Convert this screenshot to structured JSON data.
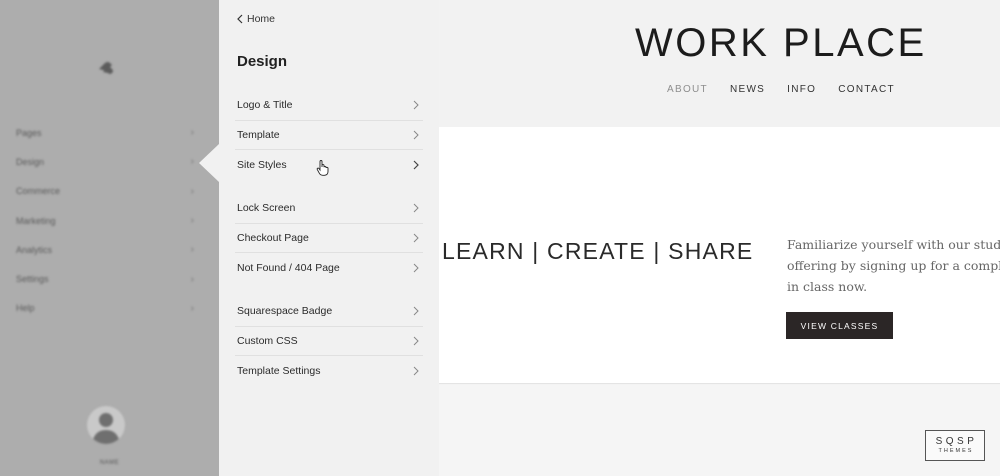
{
  "nav": {
    "items": [
      {
        "label": "Pages"
      },
      {
        "label": "Design"
      },
      {
        "label": "Commerce"
      },
      {
        "label": "Marketing"
      },
      {
        "label": "Analytics"
      },
      {
        "label": "Settings"
      },
      {
        "label": "Help"
      }
    ],
    "user_name": "NAME"
  },
  "panel": {
    "back_label": "Home",
    "title": "Design",
    "groups": [
      [
        "Logo & Title",
        "Template",
        "Site Styles"
      ],
      [
        "Lock Screen",
        "Checkout Page",
        "Not Found / 404 Page"
      ],
      [
        "Squarespace Badge",
        "Custom CSS",
        "Template Settings"
      ]
    ]
  },
  "site": {
    "title": "WORK PLACE",
    "nav": [
      "ABOUT",
      "NEWS",
      "INFO",
      "CONTACT"
    ],
    "active_nav": "ABOUT",
    "tagline": "LEARN | CREATE | SHARE",
    "intro_lines": [
      "Familiarize yourself with our stud",
      "offering by signing up for a compl",
      "in class now."
    ],
    "cta_label": "VIEW CLASSES"
  },
  "badge": {
    "top": "SQSP",
    "bottom": "THEMES"
  },
  "colors": {
    "nav_bg": "#adadad",
    "panel_bg": "#f1f1f1",
    "cta_bg": "#2b2626",
    "active_nav": "#8e8e8e"
  }
}
